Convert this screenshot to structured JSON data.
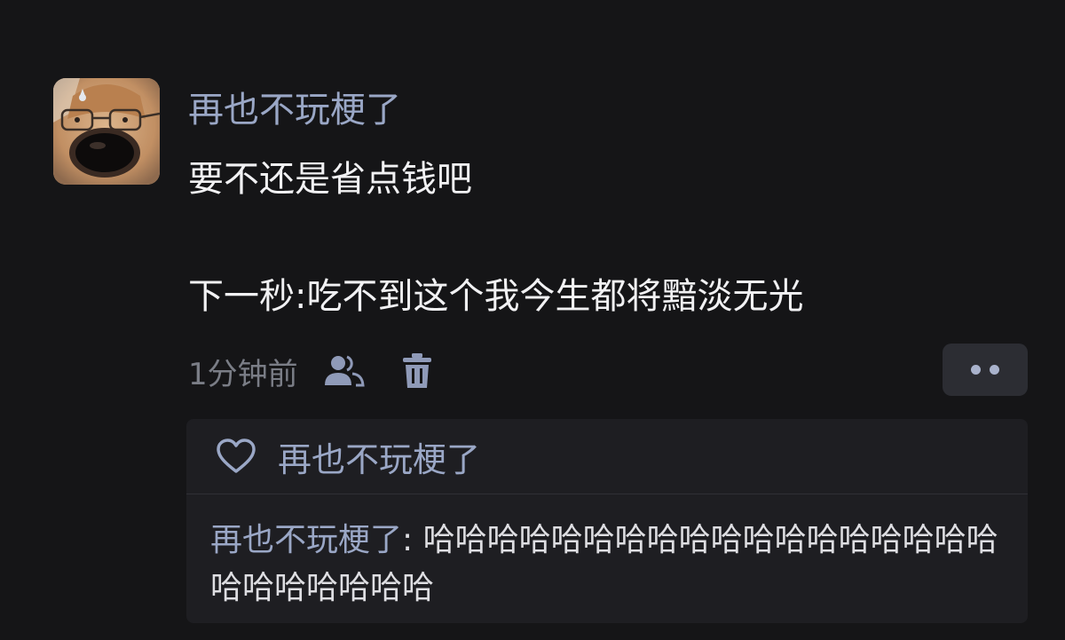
{
  "post": {
    "username": "再也不玩梗了",
    "text_line1": "要不还是省点钱吧",
    "text_line2": "下一秒:吃不到这个我今生都将黯淡无光",
    "timestamp": "1分钟前",
    "icons": {
      "visibility": "friends-icon",
      "delete": "trash-icon",
      "more": "more-dots-icon"
    }
  },
  "interactions": {
    "like_icon": "heart-icon",
    "liked_by": "再也不玩梗了",
    "reply": {
      "author": "再也不玩梗了",
      "separator": ": ",
      "text": "哈哈哈哈哈哈哈哈哈哈哈哈哈哈哈哈哈哈哈哈哈哈哈哈哈"
    }
  },
  "colors": {
    "background": "#151517",
    "panel": "#1e1e22",
    "username": "#9aa7c6",
    "text": "#f1f1f3",
    "muted": "#7a7d86",
    "icon": "#a9b2cc"
  }
}
